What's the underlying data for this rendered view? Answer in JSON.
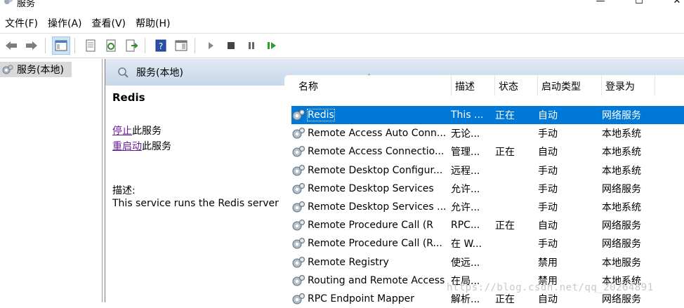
{
  "window": {
    "title": "服务"
  },
  "menu": [
    "文件(F)",
    "操作(A)",
    "查看(V)",
    "帮助(H)"
  ],
  "tree": {
    "item": "服务(本地)"
  },
  "pane": {
    "title": "服务(本地)"
  },
  "detail": {
    "service_name": "Redis",
    "stop_link": "停止",
    "stop_suffix": "此服务",
    "restart_link": "重启动",
    "restart_suffix": "此服务",
    "desc_label": "描述:",
    "desc_text": "This service runs the Redis server"
  },
  "columns": [
    "名称",
    "描述",
    "状态",
    "启动类型",
    "登录为"
  ],
  "rows": [
    {
      "name": "Redis",
      "desc": "This ...",
      "status": "正在",
      "startup": "自动",
      "logon": "网络服务",
      "selected": true
    },
    {
      "name": "Remote Access Auto Conn...",
      "desc": "无论...",
      "status": "",
      "startup": "手动",
      "logon": "本地系统"
    },
    {
      "name": "Remote Access Connectio...",
      "desc": "管理...",
      "status": "正在",
      "startup": "自动",
      "logon": "本地系统"
    },
    {
      "name": "Remote Desktop Configur...",
      "desc": "远程...",
      "status": "",
      "startup": "手动",
      "logon": "本地系统"
    },
    {
      "name": "Remote Desktop Services",
      "desc": "允许...",
      "status": "",
      "startup": "手动",
      "logon": "网络服务"
    },
    {
      "name": "Remote Desktop Services ...",
      "desc": "允许...",
      "status": "",
      "startup": "手动",
      "logon": "本地系统"
    },
    {
      "name": "Remote Procedure Call (R",
      "desc": "RPC...",
      "status": "正在",
      "startup": "自动",
      "logon": "网络服务"
    },
    {
      "name": "Remote Procedure Call (R...",
      "desc": "在 W...",
      "status": "",
      "startup": "手动",
      "logon": "网络服务"
    },
    {
      "name": "Remote Registry",
      "desc": "使远...",
      "status": "",
      "startup": "禁用",
      "logon": "本地服务"
    },
    {
      "name": "Routing and Remote Access",
      "desc": "在局...",
      "status": "",
      "startup": "禁用",
      "logon": "本地系统"
    },
    {
      "name": "RPC Endpoint Mapper",
      "desc": "解析...",
      "status": "正在",
      "startup": "自动",
      "logon": "网络服务"
    }
  ],
  "watermark": "https://blog.csdn.net/qq_20264891",
  "colors": {
    "selection": "#0078d7",
    "link": "#6a1b9a",
    "header_gradient_top": "#e0e9f4"
  }
}
